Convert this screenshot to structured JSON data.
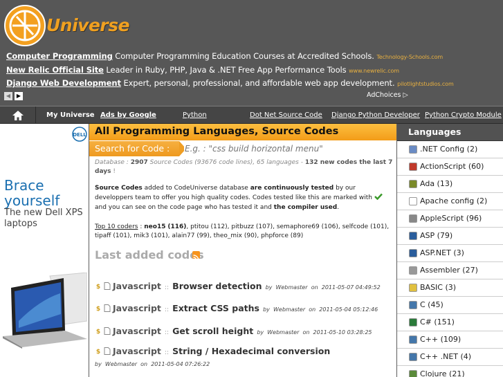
{
  "site": {
    "name": "Universe"
  },
  "ads": [
    {
      "title": "Computer Programming",
      "text": "Computer Programming Education Courses at Accredited Schools.",
      "url": "Technology-Schools.com"
    },
    {
      "title": "New Relic Official Site",
      "text": "Leader in Ruby, PHP, Java & .NET Free App Performance Tools",
      "url": "www.newrelic.com"
    },
    {
      "title": "Django Web Development",
      "text": "Expert, personal, professional, and affordable web app development.",
      "url": "pilotlightstudios.com"
    }
  ],
  "ad_nav": {
    "prev": "◀",
    "next": "▶",
    "choices": "AdChoices ▷"
  },
  "menu": [
    "My Universe",
    "Ads by Google",
    "Python",
    "Dot Net Source Code",
    "Django Python Developer",
    "Python Crypto Module"
  ],
  "left_ad": {
    "brand": "DELL",
    "headline": "Brace yourself",
    "sub": "The new Dell XPS laptops"
  },
  "main": {
    "title": "All Programming Languages, Source Codes",
    "search_label": "Search for Code :",
    "search_placeholder": "E.g. : \"css build horizontal menu\"",
    "db_prefix": "Database :",
    "db_count": "2907",
    "db_mid": "Source Codes (93676 code lines), 65 languages -",
    "db_new": "132 new codes the last 7 days",
    "db_end": "!",
    "intro_1": "Source Codes",
    "intro_2": "added to CodeUniverse database",
    "intro_3": "are continuously tested",
    "intro_4": "by our developpers team to offer you high quality codes. Codes tested like this are marked with",
    "intro_5": "and you can see on the code page who has tested it and",
    "intro_6": "the compiler used",
    "intro_7": ".",
    "top10_label": "Top 10 coders",
    "top10_sep": ":",
    "coders": [
      {
        "name": "neo15",
        "count": "(116)",
        "bold": true
      },
      {
        "name": "ptitou",
        "count": "(112)"
      },
      {
        "name": "pitbuzz",
        "count": "(107)"
      },
      {
        "name": "semaphore69",
        "count": "(106)"
      },
      {
        "name": "selfcode",
        "count": "(101)"
      },
      {
        "name": "tipaff",
        "count": "(101)"
      },
      {
        "name": "mik3",
        "count": "(101)"
      },
      {
        "name": "alain77",
        "count": "(99)"
      },
      {
        "name": "theo_mix",
        "count": "(90)"
      },
      {
        "name": "phpforce",
        "count": "(89)"
      }
    ],
    "last_added": "Last added codes",
    "codes": [
      {
        "lang": "Javascript",
        "sep": "::",
        "title": "Browser detection",
        "by": "by",
        "author": "Webmaster",
        "on": "on",
        "date": "2011-05-07 04:49:52"
      },
      {
        "lang": "Javascript",
        "sep": "::",
        "title": "Extract CSS paths",
        "by": "by",
        "author": "Webmaster",
        "on": "on",
        "date": "2011-05-04 05:12:46"
      },
      {
        "lang": "Javascript",
        "sep": "::",
        "title": "Get scroll height",
        "by": "by",
        "author": "Webmaster",
        "on": "on",
        "date": "2011-05-10 03:28:25"
      },
      {
        "lang": "Javascript",
        "sep": "::",
        "title": "String / Hexadecimal conversion",
        "by": "by",
        "author": "Webmaster",
        "on": "on",
        "date": "2011-05-04 07:26:22"
      }
    ]
  },
  "languages_title": "Languages",
  "languages": [
    {
      "name": ".NET Config (2)",
      "icon": "dotnet-config-icon",
      "color": "#6a8bc4"
    },
    {
      "name": "ActionScript (60)",
      "icon": "actionscript-icon",
      "color": "#c0392b"
    },
    {
      "name": "Ada (13)",
      "icon": "ada-icon",
      "color": "#7a8a2a"
    },
    {
      "name": "Apache config (2)",
      "icon": "apache-icon",
      "color": "#ffffff"
    },
    {
      "name": "AppleScript (96)",
      "icon": "apple-icon",
      "color": "#888888"
    },
    {
      "name": "ASP (79)",
      "icon": "asp-icon",
      "color": "#2a5d9c"
    },
    {
      "name": "ASP.NET (3)",
      "icon": "aspnet-icon",
      "color": "#2a5d9c"
    },
    {
      "name": "Assembler (27)",
      "icon": "assembler-icon",
      "color": "#999999"
    },
    {
      "name": "BASIC (3)",
      "icon": "basic-icon",
      "color": "#e0c040"
    },
    {
      "name": "C (45)",
      "icon": "c-icon",
      "color": "#4477aa"
    },
    {
      "name": "C# (151)",
      "icon": "csharp-icon",
      "color": "#2a7a3a"
    },
    {
      "name": "C++ (109)",
      "icon": "cpp-icon",
      "color": "#4477aa"
    },
    {
      "name": "C++ .NET (4)",
      "icon": "cpp-net-icon",
      "color": "#4477aa"
    },
    {
      "name": "Clojure (21)",
      "icon": "clojure-icon",
      "color": "#5a8a3a"
    }
  ]
}
